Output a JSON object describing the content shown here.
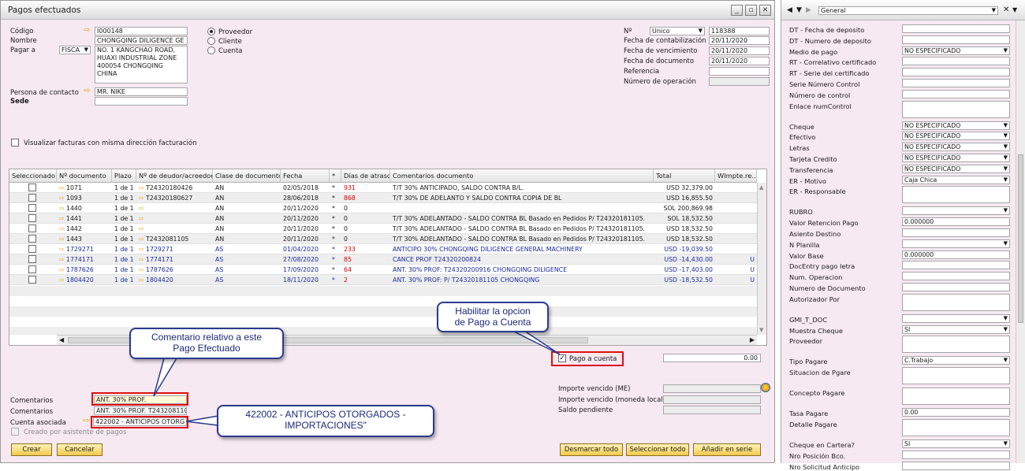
{
  "window": {
    "title": "Pagos efectuados"
  },
  "header_left": {
    "codigo_label": "Código",
    "codigo_value": "I000148",
    "nombre_label": "Nombre",
    "nombre_value": "CHONGQING DILIGENCE GE",
    "pagar_a_label": "Pagar a",
    "pagar_a_select": "FISCA",
    "address_lines": [
      "NO. 1 KANGCHAO ROAD,",
      "HUAXI INDUSTRIAL ZONE",
      "400054  CHONGQING",
      "CHINA"
    ],
    "contacto_label": "Persona de contacto",
    "contacto_value": "MR. NIKE",
    "sede_label": "Sede"
  },
  "radios": {
    "proveedor": "Proveedor",
    "cliente": "Cliente",
    "cuenta": "Cuenta"
  },
  "header_right": {
    "no_label": "Nº",
    "serie": "Unico",
    "numero": "118388",
    "fecha_contab_label": "Fecha de contabilización",
    "fecha_contab": "20/11/2020",
    "fecha_venc_label": "Fecha de vencimiento",
    "fecha_venc": "20/11/2020",
    "fecha_doc_label": "Fecha de documento",
    "fecha_doc": "20/11/2020",
    "referencia_label": "Referencia",
    "num_operacion_label": "Número de operación"
  },
  "visualizar_label": "Visualizar facturas con misma dirección facturación",
  "table": {
    "headers": [
      "Seleccionado",
      "Nº documento",
      "Plazo",
      "Nº de deudor/acreedor",
      "Clase de documento",
      "Fecha",
      "*",
      "Días de atraso",
      "Comentarios documento",
      "Total",
      "WImpte.re..."
    ],
    "rows": [
      {
        "doc": "1071",
        "plazo": "1 de 1",
        "deudor": "T24320180426",
        "clase": "AN",
        "fecha": "02/05/2018",
        "star": "*",
        "dias": "931",
        "coment": "T/T 30% ANTICIPADO, SALDO CONTRA B/L.",
        "total": "USD 32,379.00",
        "wimp": ""
      },
      {
        "doc": "1093",
        "plazo": "1 de 1",
        "deudor": "T24320180627",
        "clase": "AN",
        "fecha": "28/06/2018",
        "star": "*",
        "dias": "868",
        "coment": "T/T 30% DE ADELANTO Y SALDO CONTRA COPIA DE BL",
        "total": "USD 16,855.50",
        "wimp": ""
      },
      {
        "doc": "1440",
        "plazo": "1 de 1",
        "deudor": "",
        "clase": "AN",
        "fecha": "20/11/2020",
        "star": "*",
        "dias": "0",
        "coment": "",
        "total": "SOL 200,869.98",
        "wimp": ""
      },
      {
        "doc": "1441",
        "plazo": "1 de 1",
        "deudor": "",
        "clase": "AN",
        "fecha": "20/11/2020",
        "star": "*",
        "dias": "0",
        "coment": "T/T 30% ADELANTADO - SALDO CONTRA BL Basado en Pedidos P/ T24320181105.",
        "total": "SOL 18,532.50",
        "wimp": ""
      },
      {
        "doc": "1442",
        "plazo": "1 de 1",
        "deudor": "",
        "clase": "AN",
        "fecha": "20/11/2020",
        "star": "*",
        "dias": "0",
        "coment": "T/T 30% ADELANTADO - SALDO CONTRA BL Basado en Pedidos P/ T24320181105.",
        "total": "USD 18,532.50",
        "wimp": ""
      },
      {
        "doc": "1443",
        "plazo": "1 de 1",
        "deudor": "T2432081105",
        "clase": "AN",
        "fecha": "20/11/2020",
        "star": "*",
        "dias": "0",
        "coment": "T/T 30% ADELANTADO - SALDO CONTRA BL Basado en Pedidos P/ T24320181105.",
        "total": "USD 18,532.50",
        "wimp": ""
      },
      {
        "doc": "1729271",
        "plazo": "1 de 1",
        "deudor": "1729271",
        "clase": "AS",
        "fecha": "01/04/2020",
        "star": "*",
        "dias": "233",
        "coment": "ANTICIPO 30% CHONGQING DILIGENCE GENERAL MACHINERY",
        "total": "USD -19,039.50",
        "wimp": ""
      },
      {
        "doc": "1774171",
        "plazo": "1 de 1",
        "deudor": "1774171",
        "clase": "AS",
        "fecha": "27/08/2020",
        "star": "*",
        "dias": "85",
        "coment": "CANCE PROF T24320200824",
        "total": "USD -14,430.00",
        "wimp": "U"
      },
      {
        "doc": "1787626",
        "plazo": "1 de 1",
        "deudor": "1787626",
        "clase": "AS",
        "fecha": "17/09/2020",
        "star": "*",
        "dias": "64",
        "coment": "ANT. 30% PROF: T24320200916 CHONGQING DILIGENCE",
        "total": "USD -17,403.00",
        "wimp": "U"
      },
      {
        "doc": "1804420",
        "plazo": "1 de 1",
        "deudor": "1804420",
        "clase": "AS",
        "fecha": "18/11/2020",
        "star": "*",
        "dias": "2",
        "coment": "ANT. 30% PROF: P/ T24320181105 CHONGQING",
        "total": "USD -18,532.50",
        "wimp": "U"
      }
    ]
  },
  "pago_cuenta": {
    "label": "Pago a cuenta",
    "amount": "0.00"
  },
  "importes": {
    "vencido_me": "Importe vencido (ME)",
    "vencido_local": "Importe vencido (moneda local)",
    "saldo": "Saldo pendiente"
  },
  "footer": {
    "comentarios_label": "Comentarios",
    "comentarios_value": "ANT. 30% PROF.",
    "comentarios2_label": "Comentarios",
    "comentarios2_value": "ANT. 30% PROF. T243208110",
    "cuenta_label": "Cuenta asociada",
    "cuenta_value": "422002 - ANTICIPOS OTORG",
    "creado_label": "Creado por asistente de pagos"
  },
  "buttons": {
    "crear": "Crear",
    "cancelar": "Cancelar",
    "desmarcar": "Desmarcar todo",
    "seleccionar": "Seleccionar todo",
    "anadir": "Añadir en serie"
  },
  "callouts": {
    "habilitar": [
      "Habilitar la opcion",
      "de Pago a Cuenta"
    ],
    "comentario": [
      "Comentario relativo a este",
      "Pago Efectuado"
    ],
    "cuenta": [
      "422002 - ANTICIPOS OTORGADOS -",
      "IMPORTACIONES\""
    ]
  },
  "right_pane": {
    "header_select": "General",
    "fields": [
      {
        "label": "DT - Fecha de deposito",
        "value": "",
        "dd": false,
        "tall": false
      },
      {
        "label": "DT - Numero de deposito",
        "value": "",
        "dd": false,
        "tall": false
      },
      {
        "label": "Medio de pago",
        "value": "NO ESPECIFICADO",
        "dd": true,
        "tall": false
      },
      {
        "label": "RT - Correlativo certificado",
        "value": "",
        "dd": false,
        "tall": false
      },
      {
        "label": "RT - Serie del certificado",
        "value": "",
        "dd": false,
        "tall": false
      },
      {
        "label": "Serie Número Control",
        "value": "",
        "dd": false,
        "tall": false
      },
      {
        "label": "Número de control",
        "value": "",
        "dd": false,
        "tall": false
      },
      {
        "label": "Enlace numControl",
        "value": "",
        "dd": false,
        "tall": true
      },
      {
        "label": "Cheque",
        "value": "NO ESPECIFICADO",
        "dd": true,
        "tall": false
      },
      {
        "label": "Efectivo",
        "value": "NO ESPECIFICADO",
        "dd": true,
        "tall": false
      },
      {
        "label": "Letras",
        "value": "NO ESPECIFICADO",
        "dd": true,
        "tall": false
      },
      {
        "label": "Tarjeta Credito",
        "value": "NO ESPECIFICADO",
        "dd": true,
        "tall": false
      },
      {
        "label": "Transferencia",
        "value": "NO ESPECIFICADO",
        "dd": true,
        "tall": false
      },
      {
        "label": "ER - Motivo",
        "value": "Caja Chica",
        "dd": true,
        "tall": false
      },
      {
        "label": "ER - Responsable",
        "value": "",
        "dd": false,
        "tall": true
      },
      {
        "label": "RUBRO",
        "value": "",
        "dd": true,
        "tall": false
      },
      {
        "label": "Valor Retencion Pago",
        "value": "0.000000",
        "dd": false,
        "tall": false
      },
      {
        "label": "Asiento Destino",
        "value": "",
        "dd": false,
        "tall": false
      },
      {
        "label": "N Planilla",
        "value": "",
        "dd": true,
        "tall": false
      },
      {
        "label": "Valor Base",
        "value": "0.000000",
        "dd": false,
        "tall": false
      },
      {
        "label": "DocEntry pago letra",
        "value": "",
        "dd": false,
        "tall": false
      },
      {
        "label": "Num. Operacion",
        "value": "",
        "dd": false,
        "tall": false
      },
      {
        "label": "Numero de Documento",
        "value": "",
        "dd": false,
        "tall": false
      },
      {
        "label": "Autorizador Por",
        "value": "",
        "dd": false,
        "tall": true
      },
      {
        "label": "GMI_T_DOC",
        "value": "",
        "dd": true,
        "tall": false
      },
      {
        "label": "Muestra Cheque",
        "value": "SI",
        "dd": true,
        "tall": false
      },
      {
        "label": "Proveedor",
        "value": "",
        "dd": false,
        "tall": true
      },
      {
        "label": "Tipo Pagare",
        "value": "C.Trabajo",
        "dd": true,
        "tall": false
      },
      {
        "label": "Situacion de Pgare",
        "value": "",
        "dd": false,
        "tall": true
      },
      {
        "label": "Concepto Pagare",
        "value": "",
        "dd": false,
        "tall": true
      },
      {
        "label": "Tasa Pagare",
        "value": "0.00",
        "dd": false,
        "tall": false
      },
      {
        "label": "Detalle Pagare",
        "value": "",
        "dd": false,
        "tall": true
      },
      {
        "label": "Cheque en Cartera?",
        "value": "SI",
        "dd": true,
        "tall": false
      },
      {
        "label": "Nro Posición Bco.",
        "value": "",
        "dd": false,
        "tall": false
      },
      {
        "label": "Nro Solicitud Anticipo",
        "value": "",
        "dd": false,
        "tall": false
      }
    ]
  }
}
